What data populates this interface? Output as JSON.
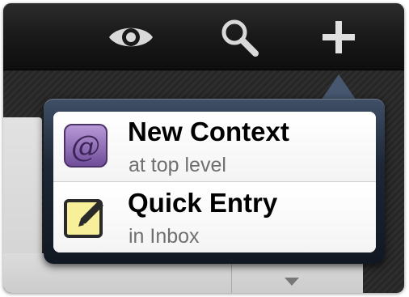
{
  "toolbar": {
    "buttons": [
      {
        "icon": "eye-icon"
      },
      {
        "icon": "search-icon"
      },
      {
        "icon": "plus-icon"
      }
    ]
  },
  "popover": {
    "items": [
      {
        "title": "New Context",
        "subtitle": "at top level",
        "icon": "context-at-icon"
      },
      {
        "title": "Quick Entry",
        "subtitle": "in Inbox",
        "icon": "quick-entry-pencil-icon"
      }
    ]
  },
  "colors": {
    "toolbar": "#151515",
    "popover_frame": "#1d2736",
    "context_icon": "#8a67b0",
    "quick_entry_icon": "#f7ef9a"
  }
}
